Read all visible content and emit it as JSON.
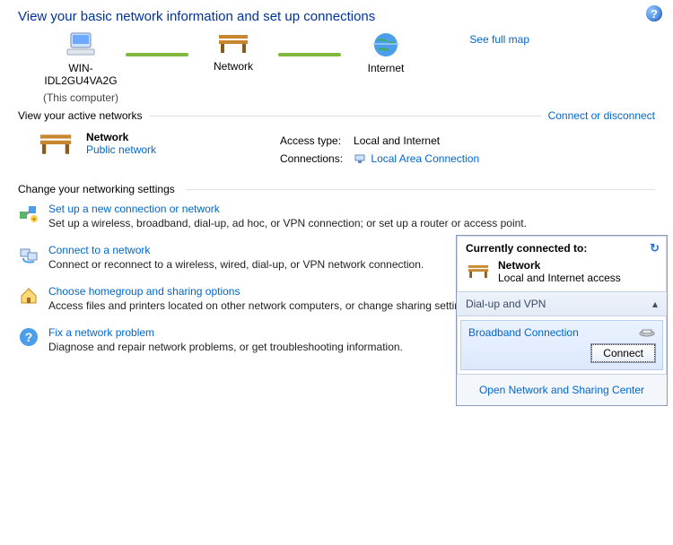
{
  "header": {
    "title": "View your basic network information and set up connections"
  },
  "map": {
    "see_full_map": "See full map",
    "nodes": [
      {
        "label": "WIN-IDL2GU4VA2G",
        "sub": "(This computer)"
      },
      {
        "label": "Network",
        "sub": ""
      },
      {
        "label": "Internet",
        "sub": ""
      }
    ]
  },
  "active_networks": {
    "section_label": "View your active networks",
    "connect_disconnect": "Connect or disconnect",
    "network": {
      "name": "Network",
      "category": "Public network",
      "access_type_label": "Access type:",
      "access_type_value": "Local and Internet",
      "connections_label": "Connections:",
      "connection_link": "Local Area Connection"
    }
  },
  "settings": {
    "section_label": "Change your networking settings",
    "tasks": [
      {
        "title": "Set up a new connection or network",
        "desc": "Set up a wireless, broadband, dial-up, ad hoc, or VPN connection; or set up a router or access point."
      },
      {
        "title": "Connect to a network",
        "desc": "Connect or reconnect to a wireless, wired, dial-up, or VPN network connection."
      },
      {
        "title": "Choose homegroup and sharing options",
        "desc": "Access files and printers located on other network computers, or change sharing settings."
      },
      {
        "title": "Fix a network problem",
        "desc": "Diagnose and repair network problems, or get troubleshooting information."
      }
    ]
  },
  "flyout": {
    "currently_connected": "Currently connected to:",
    "network_name": "Network",
    "network_access": "Local and Internet access",
    "dialup_section": "Dial-up and VPN",
    "broadband_item": "Broadband Connection",
    "connect_button": "Connect",
    "footer_link": "Open Network and Sharing Center"
  }
}
